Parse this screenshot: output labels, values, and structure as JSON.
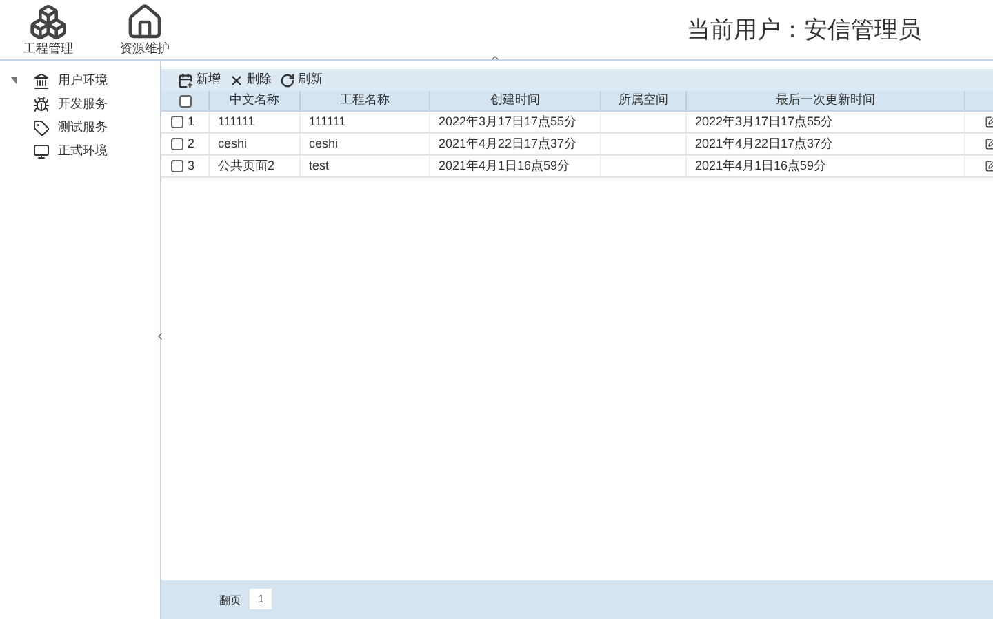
{
  "header": {
    "nav": [
      {
        "label": "工程管理"
      },
      {
        "label": "资源维护"
      }
    ],
    "current_user": "当前用户：安信管理员"
  },
  "sidebar": {
    "items": [
      {
        "label": "用户环境",
        "expanded": true
      },
      {
        "label": "开发服务",
        "expanded": false
      },
      {
        "label": "测试服务",
        "expanded": false
      },
      {
        "label": "正式环境",
        "expanded": false
      }
    ]
  },
  "toolbar": [
    {
      "label": "新增"
    },
    {
      "label": "删除"
    },
    {
      "label": "刷新"
    }
  ],
  "table": {
    "select_all": false,
    "columns": [
      "中文名称",
      "工程名称",
      "创建时间",
      "所属空间",
      "最后一次更新时间"
    ],
    "rows": [
      {
        "checked": false,
        "number": "1",
        "cells": [
          "111111",
          "111111",
          "2022年3月17日17点55分",
          "",
          "2022年3月17日17点55分"
        ]
      },
      {
        "checked": false,
        "number": "2",
        "cells": [
          "ceshi",
          "ceshi",
          "2021年4月22日17点37分",
          "",
          "2021年4月22日17点37分"
        ]
      },
      {
        "checked": false,
        "number": "3",
        "cells": [
          "公共页面2",
          "test",
          "2021年4月1日16点59分",
          "",
          "2021年4月1日16点59分"
        ]
      }
    ]
  },
  "pager": {
    "label": "翻页",
    "value": "1"
  }
}
